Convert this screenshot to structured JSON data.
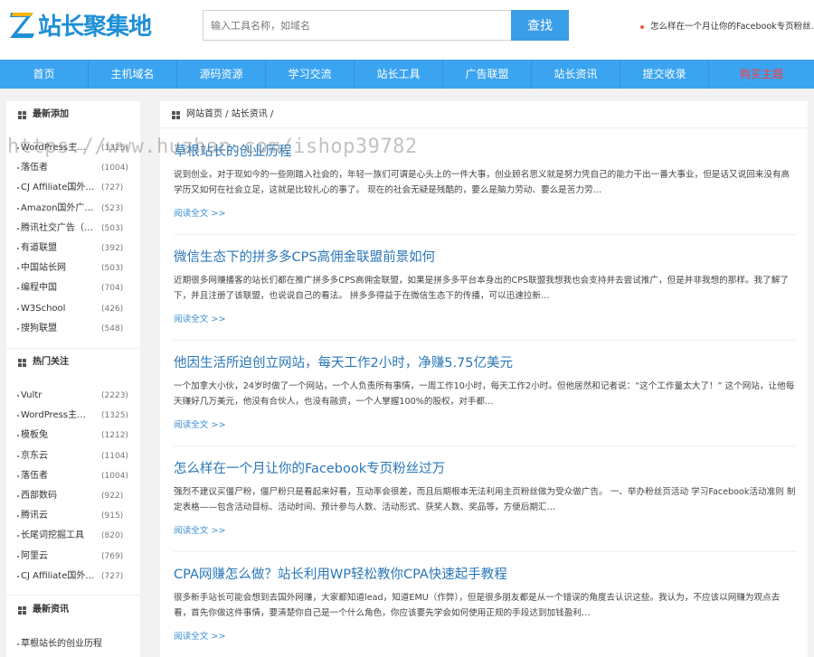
{
  "header": {
    "logo_text": "站长聚集地",
    "search_placeholder": "输入工具名称，如域名",
    "search_button": "查找",
    "ticker_text": "怎么样在一个月让你的Facebook专页粉丝…"
  },
  "nav": {
    "items": [
      {
        "label": "首页"
      },
      {
        "label": "主机域名"
      },
      {
        "label": "源码资源"
      },
      {
        "label": "学习交流"
      },
      {
        "label": "站长工具"
      },
      {
        "label": "广告联盟"
      },
      {
        "label": "站长资讯"
      },
      {
        "label": "提交收录"
      },
      {
        "label": "购买主题"
      }
    ]
  },
  "sidebar": {
    "newest": {
      "title": "最新添加",
      "items": [
        {
          "name": "WordPress主…",
          "count": "(1325)"
        },
        {
          "name": "落伍者",
          "count": "(1004)"
        },
        {
          "name": "CJ Affiliate国外…",
          "count": "(727)"
        },
        {
          "name": "Amazon国外广…",
          "count": "(523)"
        },
        {
          "name": "腾讯社交广告（…",
          "count": "(503)"
        },
        {
          "name": "有道联盟",
          "count": "(392)"
        },
        {
          "name": "中国站长网",
          "count": "(503)"
        },
        {
          "name": "编程中国",
          "count": "(704)"
        },
        {
          "name": "W3School",
          "count": "(426)"
        },
        {
          "name": "搜狗联盟",
          "count": "(548)"
        }
      ]
    },
    "hot": {
      "title": "热门关注",
      "items": [
        {
          "name": "Vultr",
          "count": "(2223)"
        },
        {
          "name": "WordPress主…",
          "count": "(1325)"
        },
        {
          "name": "模板兔",
          "count": "(1212)"
        },
        {
          "name": "京东云",
          "count": "(1104)"
        },
        {
          "name": "落伍者",
          "count": "(1004)"
        },
        {
          "name": "西部数码",
          "count": "(922)"
        },
        {
          "name": "腾讯云",
          "count": "(915)"
        },
        {
          "name": "长尾词挖掘工具",
          "count": "(820)"
        },
        {
          "name": "阿里云",
          "count": "(769)"
        },
        {
          "name": "CJ Affiliate国外…",
          "count": "(727)"
        }
      ]
    },
    "news": {
      "title": "最新资讯",
      "items": [
        {
          "name": "草根站长的创业历程"
        }
      ]
    }
  },
  "breadcrumb": {
    "text": "网站首页 / 站长资讯 /"
  },
  "articles": [
    {
      "title": "草根站长的创业历程",
      "body": "说到创业，对于现如今的一些刚踏入社会的，年轻一族们可谓是心头上的一件大事，创业顾名思义就是努力凭自己的能力干出一番大事业，但是话又说回来没有高学历又如何在社会立足，这就是比较扎心的事了。 现在的社会无疑是残酷的，要么是脑力劳动、要么是苦力劳…",
      "more": "阅读全文 >>"
    },
    {
      "title": "微信生态下的拼多多CPS高佣金联盟前景如何",
      "body": "近期很多网赚播客的站长们都在推广拼多多CPS高佣金联盟，如果是拼多多平台本身出的CPS联盟我想我也会支持并去尝试推广，但是并非我想的那样。我了解了下，并且注册了该联盟，也说说自己的看法。    拼多多得益于在微信生态下的传播，可以迅速拉新…",
      "more": "阅读全文 >>"
    },
    {
      "title": "他因生活所迫创立网站，每天工作2小时，净赚5.75亿美元",
      "body": " 一个加拿大小伙，24岁时做了一个网站，一个人负责所有事情，一周工作10小时，每天工作2小时。但他居然和记者说：“这个工作量太大了！” 这个网站，让他每天赚好几万美元，他没有合伙人，也没有融资，一个人掌握100%的股权，对手都…",
      "more": "阅读全文 >>"
    },
    {
      "title": "怎么样在一个月让你的Facebook专页粉丝过万",
      "body": "强烈不建议买僵尸粉，僵尸粉只是看起来好看，互动率会很差，而且后期根本无法利用主页粉丝做为受众做广告。 一、举办粉丝页活动 学习Facebook活动准则 制定表格——包含活动目标、活动时间、预计参与人数、活动形式、获奖人数、奖品等，方便后期汇…",
      "more": "阅读全文 >>"
    },
    {
      "title": "CPA网赚怎么做？站长利用WP轻松教你CPA快速起手教程",
      "body": "很多新手站长可能会想到去国外网赚，大家都知道lead，知道EMU（作弊），但是很多朋友都是从一个错误的角度去认识这些。我认为，不应该以网赚为观点去看，首先你做这件事情，要清楚你自己是一个什么角色，你应该要先学会如何使用正规的手段达到加钱盈利…",
      "more": "阅读全文 >>"
    }
  ],
  "watermark": "https://www.huzhan.com/ishop39782",
  "colors": {
    "nav_bg": "#3aa4f0",
    "accent": "#3b9ee8",
    "title_link": "#2a77b8",
    "buy_theme": "#ff3b3b"
  }
}
